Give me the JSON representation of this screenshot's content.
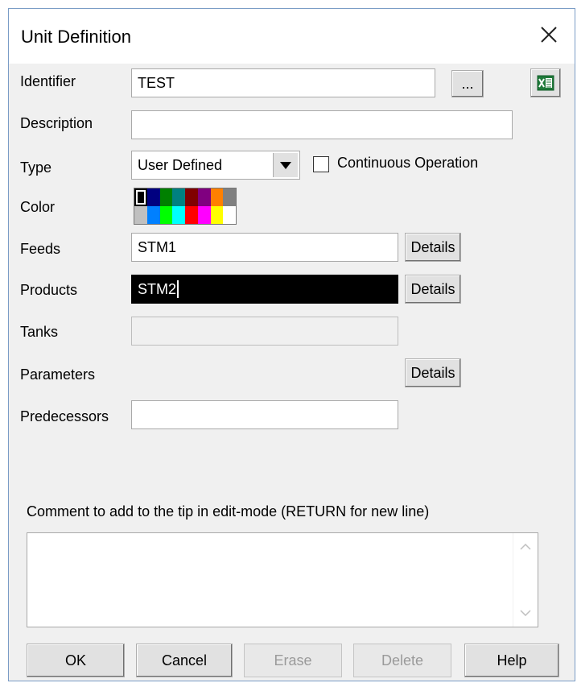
{
  "window": {
    "title": "Unit Definition",
    "close_glyph": "✕"
  },
  "labels": {
    "identifier": "Identifier",
    "description": "Description",
    "type": "Type",
    "color": "Color",
    "feeds": "Feeds",
    "products": "Products",
    "tanks": "Tanks",
    "parameters": "Parameters",
    "predecessors": "Predecessors",
    "comment": "Comment to add to the tip in edit-mode (RETURN for new line)"
  },
  "fields": {
    "identifier": "TEST",
    "description": "",
    "type": "User Defined",
    "feeds": "STM1",
    "products": "STM2",
    "tanks": "",
    "predecessors": "",
    "comment": ""
  },
  "checkbox": {
    "label": "Continuous Operation",
    "checked": false
  },
  "buttons": {
    "browse": "...",
    "details_feeds": "Details",
    "details_products": "Details",
    "details_parameters": "Details",
    "ok": "OK",
    "cancel": "Cancel",
    "erase": "Erase",
    "delete": "Delete",
    "help": "Help"
  },
  "icons": {
    "excel": "excel-icon",
    "dropdown": "chevron-down-icon"
  },
  "palette": {
    "selected": 0,
    "colors": [
      [
        "#000000",
        "#000080",
        "#008000",
        "#008080",
        "#800000",
        "#800080",
        "#ff8000",
        "#808080"
      ],
      [
        "#c0c0c0",
        "#0080ff",
        "#00ff00",
        "#00ffff",
        "#ff0000",
        "#ff00ff",
        "#ffff00",
        "#ffffff"
      ]
    ]
  }
}
